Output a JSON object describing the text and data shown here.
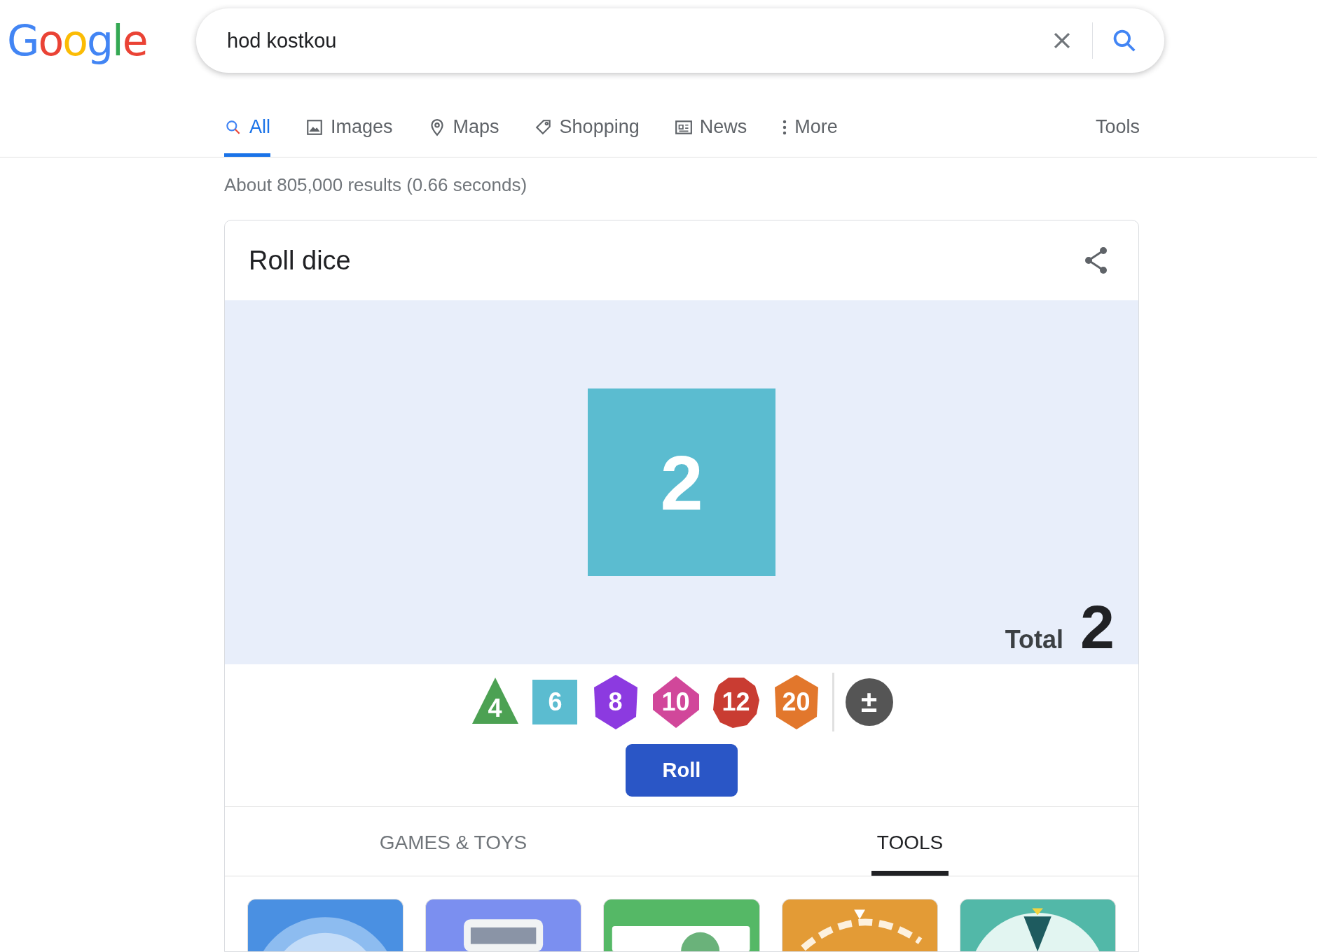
{
  "logo": {
    "letters": [
      {
        "char": "G",
        "color": "#4285f4"
      },
      {
        "char": "o",
        "color": "#ea4335"
      },
      {
        "char": "o",
        "color": "#fbbc05"
      },
      {
        "char": "g",
        "color": "#4285f4"
      },
      {
        "char": "l",
        "color": "#34a853"
      },
      {
        "char": "e",
        "color": "#ea4335"
      }
    ]
  },
  "search": {
    "value": "hod kostkou"
  },
  "tabs": [
    {
      "label": "All",
      "kind": "search",
      "selected": true
    },
    {
      "label": "Images",
      "kind": "image",
      "selected": false
    },
    {
      "label": "Maps",
      "kind": "pin",
      "selected": false
    },
    {
      "label": "Shopping",
      "kind": "tag",
      "selected": false
    },
    {
      "label": "News",
      "kind": "news",
      "selected": false
    },
    {
      "label": "More",
      "kind": "dots",
      "selected": false
    }
  ],
  "tools_link": "Tools",
  "result_stats": "About 805,000 results (0.66 seconds)",
  "card": {
    "title": "Roll dice",
    "rolled": [
      {
        "value": "2",
        "color": "#5bbcd0"
      }
    ],
    "total_label": "Total",
    "total_value": "2",
    "dice": [
      {
        "label": "4",
        "kind": "triangle",
        "color": "#4ca153"
      },
      {
        "label": "6",
        "kind": "square",
        "color": "#5bbcd0"
      },
      {
        "label": "8",
        "kind": "hexagon",
        "color": "#8c3ae0"
      },
      {
        "label": "10",
        "kind": "rhombus",
        "color": "#d1479a"
      },
      {
        "label": "12",
        "kind": "decagon",
        "color": "#c93c32"
      },
      {
        "label": "20",
        "kind": "hexagon",
        "color": "#e2772c"
      }
    ],
    "modifier": "±",
    "roll_button": "Roll",
    "category_tabs": [
      {
        "label": "GAMES & TOYS",
        "selected": false
      },
      {
        "label": "TOOLS",
        "selected": true
      }
    ],
    "tiles": [
      {
        "kind": "rings",
        "color": "#4a90e2"
      },
      {
        "kind": "calculator",
        "color": "#7b8ff0"
      },
      {
        "kind": "screen",
        "color": "#55b866"
      },
      {
        "kind": "dial",
        "color": "#e39b36"
      },
      {
        "kind": "wheel",
        "color": "#52b8a8"
      }
    ]
  }
}
